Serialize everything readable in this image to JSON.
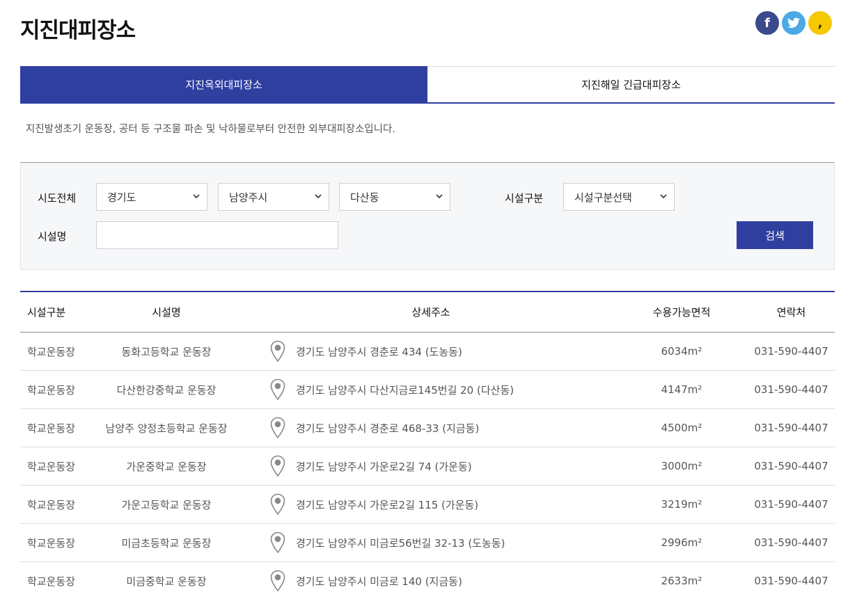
{
  "page": {
    "title": "지진대피장소"
  },
  "social": [
    {
      "name": "facebook-icon",
      "glyph": "f"
    },
    {
      "name": "twitter-icon",
      "glyph": "t"
    },
    {
      "name": "kakaostory-icon",
      "glyph": ","
    }
  ],
  "tabs": [
    {
      "label": "지진옥외대피장소",
      "active": true
    },
    {
      "label": "지진해일 긴급대피장소",
      "active": false
    }
  ],
  "description": "지진발생초기 운동장, 공터 등 구조물 파손 및 낙하물로부터 안전한 외부대피장소입니다.",
  "search": {
    "region_label": "시도전체",
    "province": "경기도",
    "city": "남양주시",
    "district": "다산동",
    "facility_type_label": "시설구분",
    "facility_type": "시설구분선택",
    "facility_name_label": "시설명",
    "facility_name_value": "",
    "search_button": "검색"
  },
  "table": {
    "headers": [
      "시설구분",
      "시설명",
      "상세주소",
      "수용가능면적",
      "연락처"
    ],
    "rows": [
      {
        "type": "학교운동장",
        "name": "동화고등학교 운동장",
        "address": "경기도 남양주시 경춘로 434 (도농동)",
        "area": "6034m²",
        "phone": "031-590-4407"
      },
      {
        "type": "학교운동장",
        "name": "다산한강중학교 운동장",
        "address": "경기도 남양주시 다산지금로145번길 20 (다산동)",
        "area": "4147m²",
        "phone": "031-590-4407"
      },
      {
        "type": "학교운동장",
        "name": "남양주 양정초등학교 운동장",
        "address": "경기도 남양주시 경춘로 468-33 (지금동)",
        "area": "4500m²",
        "phone": "031-590-4407"
      },
      {
        "type": "학교운동장",
        "name": "가운중학교 운동장",
        "address": "경기도 남양주시 가운로2길 74 (가운동)",
        "area": "3000m²",
        "phone": "031-590-4407"
      },
      {
        "type": "학교운동장",
        "name": "가운고등학교 운동장",
        "address": "경기도 남양주시 가운로2길 115 (가운동)",
        "area": "3219m²",
        "phone": "031-590-4407"
      },
      {
        "type": "학교운동장",
        "name": "미금초등학교 운동장",
        "address": "경기도 남양주시 미금로56번길 32-13 (도농동)",
        "area": "2996m²",
        "phone": "031-590-4407"
      },
      {
        "type": "학교운동장",
        "name": "미금중학교 운동장",
        "address": "경기도 남양주시 미금로 140 (지금동)",
        "area": "2633m²",
        "phone": "031-590-4407"
      }
    ]
  },
  "colors": {
    "primary": "#2f3fa0",
    "facebook": "#3b4a8c",
    "twitter": "#4ba9e6",
    "kakao": "#f6c800"
  }
}
